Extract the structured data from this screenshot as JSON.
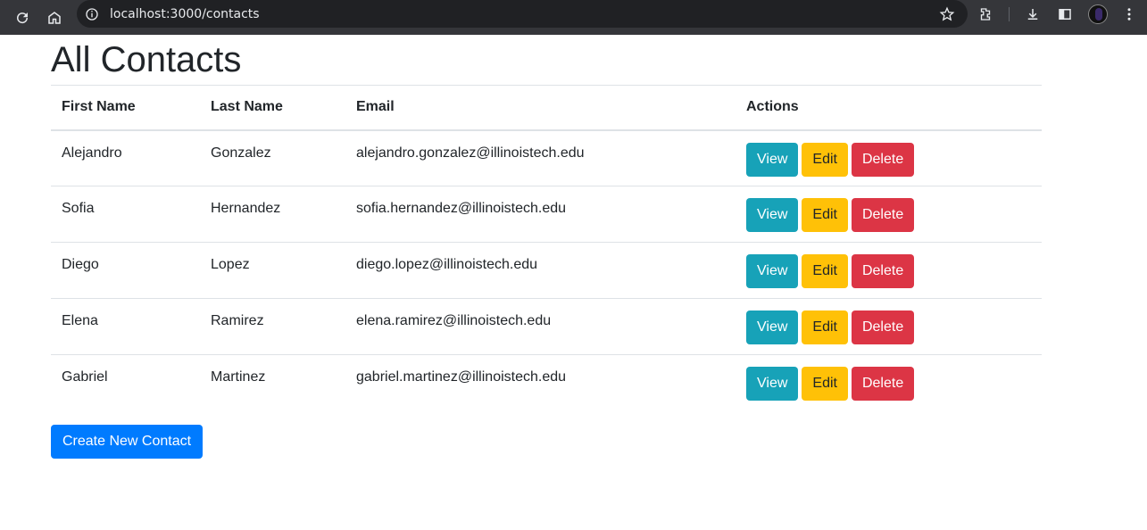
{
  "browser": {
    "url": "localhost:3000/contacts",
    "icons": [
      "reload-icon",
      "home-icon",
      "info-icon",
      "star-icon",
      "extensions-icon",
      "download-icon",
      "sidepanel-icon",
      "avatar",
      "menu-icon"
    ]
  },
  "page": {
    "title": "All Contacts",
    "columns": [
      "First Name",
      "Last Name",
      "Email",
      "Actions"
    ],
    "rows": [
      {
        "first": "Alejandro",
        "last": "Gonzalez",
        "email": "alejandro.gonzalez@illinoistech.edu"
      },
      {
        "first": "Sofia",
        "last": "Hernandez",
        "email": "sofia.hernandez@illinoistech.edu"
      },
      {
        "first": "Diego",
        "last": "Lopez",
        "email": "diego.lopez@illinoistech.edu"
      },
      {
        "first": "Elena",
        "last": "Ramirez",
        "email": "elena.ramirez@illinoistech.edu"
      },
      {
        "first": "Gabriel",
        "last": "Martinez",
        "email": "gabriel.martinez@illinoistech.edu"
      }
    ],
    "actions": {
      "view": "View",
      "edit": "Edit",
      "delete": "Delete"
    },
    "create_label": "Create New Contact"
  },
  "colors": {
    "view": "#17a2b8",
    "edit": "#ffc107",
    "delete": "#dc3545",
    "primary": "#007bff",
    "chrome": "#35363a"
  }
}
